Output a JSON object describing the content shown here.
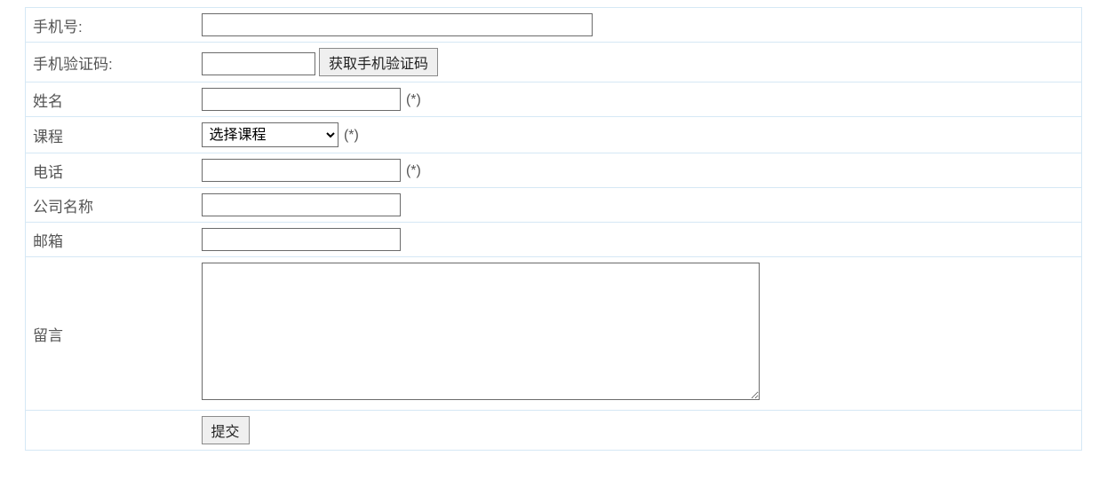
{
  "form": {
    "phone_number": {
      "label": "手机号:",
      "value": ""
    },
    "phone_code": {
      "label": "手机验证码:",
      "value": "",
      "button_label": "获取手机验证码"
    },
    "name": {
      "label": "姓名",
      "value": "",
      "required_mark": "(*)"
    },
    "course": {
      "label": "课程",
      "selected": "选择课程",
      "required_mark": "(*)"
    },
    "telephone": {
      "label": "电话",
      "value": "",
      "required_mark": "(*)"
    },
    "company": {
      "label": "公司名称",
      "value": ""
    },
    "email": {
      "label": "邮箱",
      "value": ""
    },
    "message": {
      "label": "留言",
      "value": ""
    },
    "submit": {
      "label": "提交"
    }
  }
}
